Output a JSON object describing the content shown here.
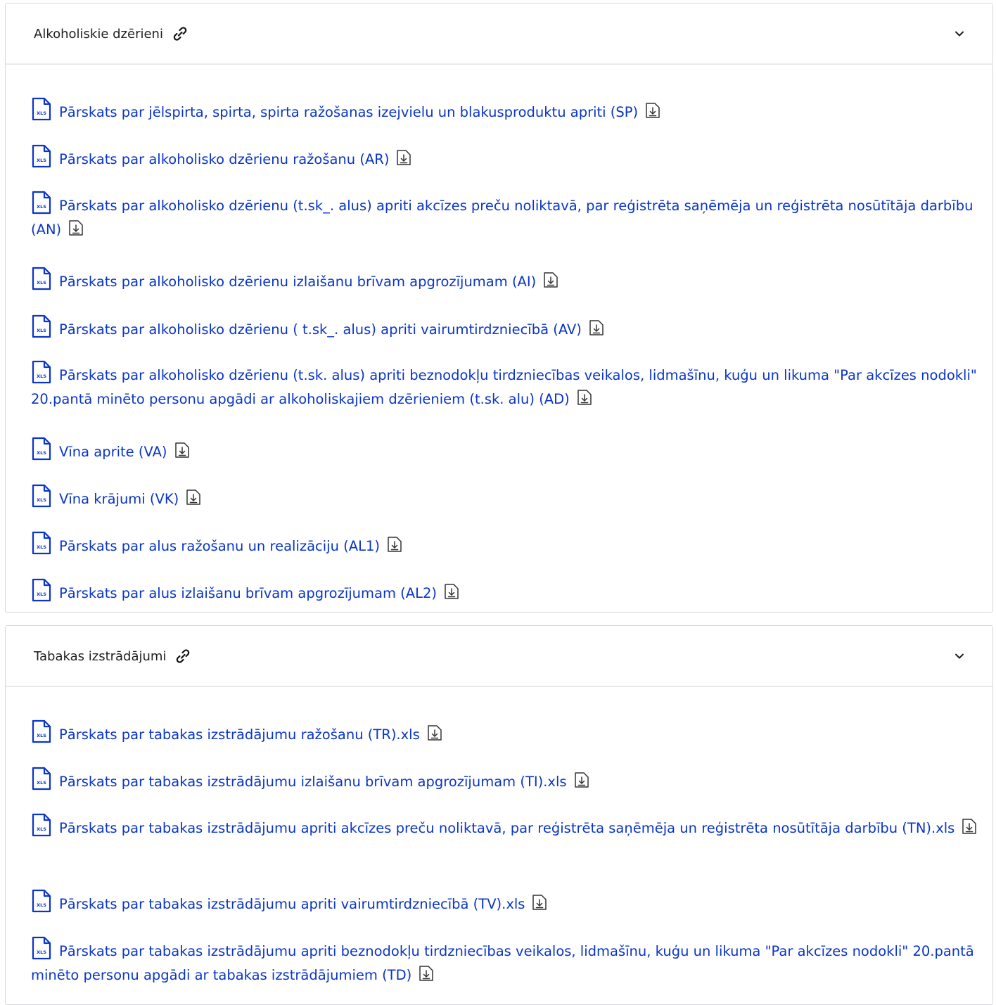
{
  "sections": [
    {
      "title": "Alkoholiskie dzērieni",
      "items": [
        "Pārskats par jēlspirta, spirta, spirta ražošanas izejvielu un blakusproduktu apriti (SP)",
        "Pārskats par alkoholisko dzērienu ražošanu (AR)",
        "Pārskats par alkoholisko dzērienu (t.sk_. alus) apriti akcīzes preču noliktavā, par reģistrēta saņēmēja un reģistrēta nosūtītāja darbību (AN)",
        "Pārskats par alkoholisko dzērienu izlaišanu brīvam apgrozījumam (AI)",
        "Pārskats par alkoholisko dzērienu ( t.sk_. alus) apriti vairumtirdzniecībā (AV)",
        "Pārskats par alkoholisko dzērienu (t.sk. alus) apriti beznodokļu tirdzniecības veikalos, lidmašīnu, kuģu un likuma \"Par akcīzes nodokli\" 20.pantā minēto personu apgādi ar alkoholiskajiem dzērieniem (t.sk. alu) (AD)",
        "Vīna aprite (VA)",
        "Vīna krājumi (VK)",
        "Pārskats par alus ražošanu un realizāciju (AL1)",
        "Pārskats par alus izlaišanu brīvam apgrozījumam (AL2)"
      ]
    },
    {
      "title": "Tabakas izstrādājumi",
      "items": [
        "Pārskats par tabakas izstrādājumu ražošanu (TR).xls",
        "Pārskats par tabakas izstrādājumu izlaišanu brīvam apgrozījumam (TI).xls",
        "Pārskats par tabakas izstrādājumu apriti akcīzes preču noliktavā, par reģistrēta saņēmēja un reģistrēta nosūtītāja darbību (TN).xls",
        "Pārskats par tabakas izstrādājumu apriti vairumtirdzniecībā (TV).xls",
        "Pārskats par tabakas izstrādājumu apriti beznodokļu tirdzniecības veikalos, lidmašīnu, kuģu un likuma \"Par akcīzes nodokli\" 20.pantā minēto personu apgādi ar tabakas izstrādājumiem (TD)"
      ]
    }
  ],
  "icons": {
    "file": "xls-file-icon",
    "file_badge": "XLS",
    "download": "download-icon",
    "link": "link-icon",
    "expand": "chevron-down-icon"
  },
  "colors": {
    "link": "#0a35c7",
    "title": "#1d1f22",
    "border": "#d6d8db"
  }
}
